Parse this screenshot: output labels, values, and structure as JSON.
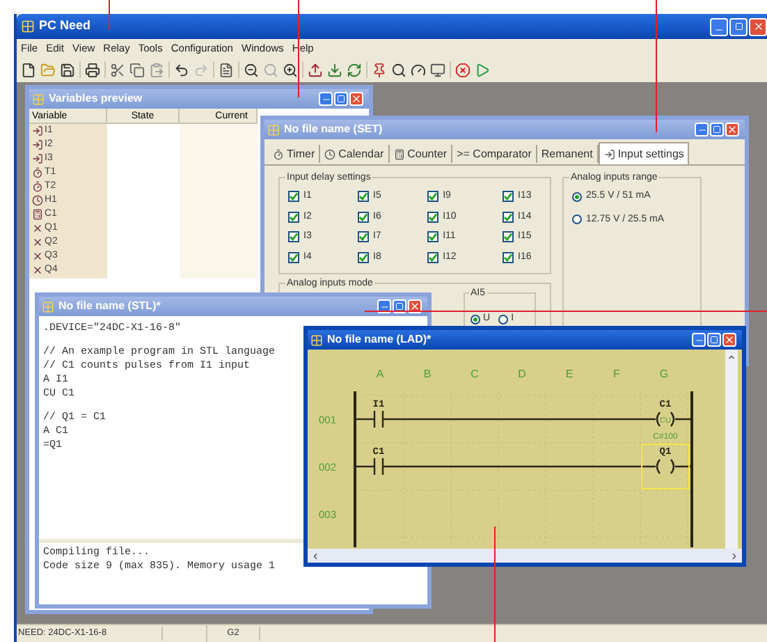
{
  "app_window": {
    "title": "PC Need",
    "active": true
  },
  "menu": [
    "File",
    "Edit",
    "View",
    "Relay",
    "Tools",
    "Configuration",
    "Windows",
    "Help"
  ],
  "variables_window": {
    "title": "Variables preview",
    "active": false,
    "columns": [
      "Variable",
      "State",
      "Current"
    ],
    "rows": [
      {
        "kind": "input",
        "name": "I1"
      },
      {
        "kind": "input",
        "name": "I2"
      },
      {
        "kind": "input",
        "name": "I3"
      },
      {
        "kind": "timer",
        "name": "T1"
      },
      {
        "kind": "timer",
        "name": "T2"
      },
      {
        "kind": "clock",
        "name": "H1"
      },
      {
        "kind": "counter",
        "name": "C1"
      },
      {
        "kind": "output",
        "name": "Q1"
      },
      {
        "kind": "output",
        "name": "Q2"
      },
      {
        "kind": "output",
        "name": "Q3"
      },
      {
        "kind": "output",
        "name": "Q4"
      }
    ]
  },
  "set_window": {
    "title": "No file name (SET)",
    "active": false,
    "tabs": [
      {
        "kind": "timer",
        "label": "Timer",
        "selected": false
      },
      {
        "kind": "calendar",
        "label": "Calendar",
        "selected": false
      },
      {
        "kind": "counter",
        "label": "Counter",
        "selected": false
      },
      {
        "kind": "plain",
        "label": ">= Comparator",
        "selected": false
      },
      {
        "kind": "plain",
        "label": "Remanent",
        "selected": false
      },
      {
        "kind": "input",
        "label": "Input settings",
        "selected": true
      }
    ],
    "input_delay": {
      "title": "Input delay settings",
      "inputs": [
        {
          "label": "I1",
          "checked": true
        },
        {
          "label": "I2",
          "checked": true
        },
        {
          "label": "I3",
          "checked": true
        },
        {
          "label": "I4",
          "checked": true
        },
        {
          "label": "I5",
          "checked": true
        },
        {
          "label": "I6",
          "checked": true
        },
        {
          "label": "I7",
          "checked": true
        },
        {
          "label": "I8",
          "checked": true
        },
        {
          "label": "I9",
          "checked": true
        },
        {
          "label": "I10",
          "checked": true
        },
        {
          "label": "I11",
          "checked": true
        },
        {
          "label": "I12",
          "checked": true
        },
        {
          "label": "I13",
          "checked": true
        },
        {
          "label": "I14",
          "checked": true
        },
        {
          "label": "I15",
          "checked": true
        },
        {
          "label": "I16",
          "checked": true
        }
      ]
    },
    "analog_range": {
      "title": "Analog inputs range",
      "options": [
        {
          "label": "25.5 V / 51 mA",
          "selected": true
        },
        {
          "label": "12.75 V / 25.5 mA",
          "selected": false
        }
      ]
    },
    "analog_mode": {
      "title": "Analog inputs mode",
      "group": {
        "title": "AI5",
        "options": [
          {
            "label": "U",
            "selected": true
          },
          {
            "label": "I",
            "selected": false
          }
        ]
      }
    }
  },
  "stl_window": {
    "title": "No file name (STL)*",
    "active": false,
    "code": [
      [
        ".DEVICE=\"24DC-X1-16-8\""
      ],
      [
        "// An example program in STL language",
        "// C1 counts pulses from I1 input",
        "A I1",
        "CU C1"
      ],
      [
        "// Q1 = C1",
        "A C1",
        "=Q1"
      ]
    ],
    "output": [
      "Compiling file...",
      "Code size 9 (max 835). Memory usage 1"
    ]
  },
  "lad_window": {
    "title": "No file name (LAD)*",
    "active": true,
    "columns": [
      "A",
      "B",
      "C",
      "D",
      "E",
      "F",
      "G"
    ],
    "rungs": [
      {
        "number": "001",
        "contact": "I1",
        "coil": {
          "name": "C1",
          "inner": "CU",
          "note": "C#100",
          "selected": false
        }
      },
      {
        "number": "002",
        "contact": "C1",
        "coil": {
          "name": "Q1",
          "selected": true
        }
      },
      {
        "number": "003"
      }
    ]
  },
  "status_bar": [
    "NEED: 24DC-X1-16-8",
    "G2"
  ]
}
